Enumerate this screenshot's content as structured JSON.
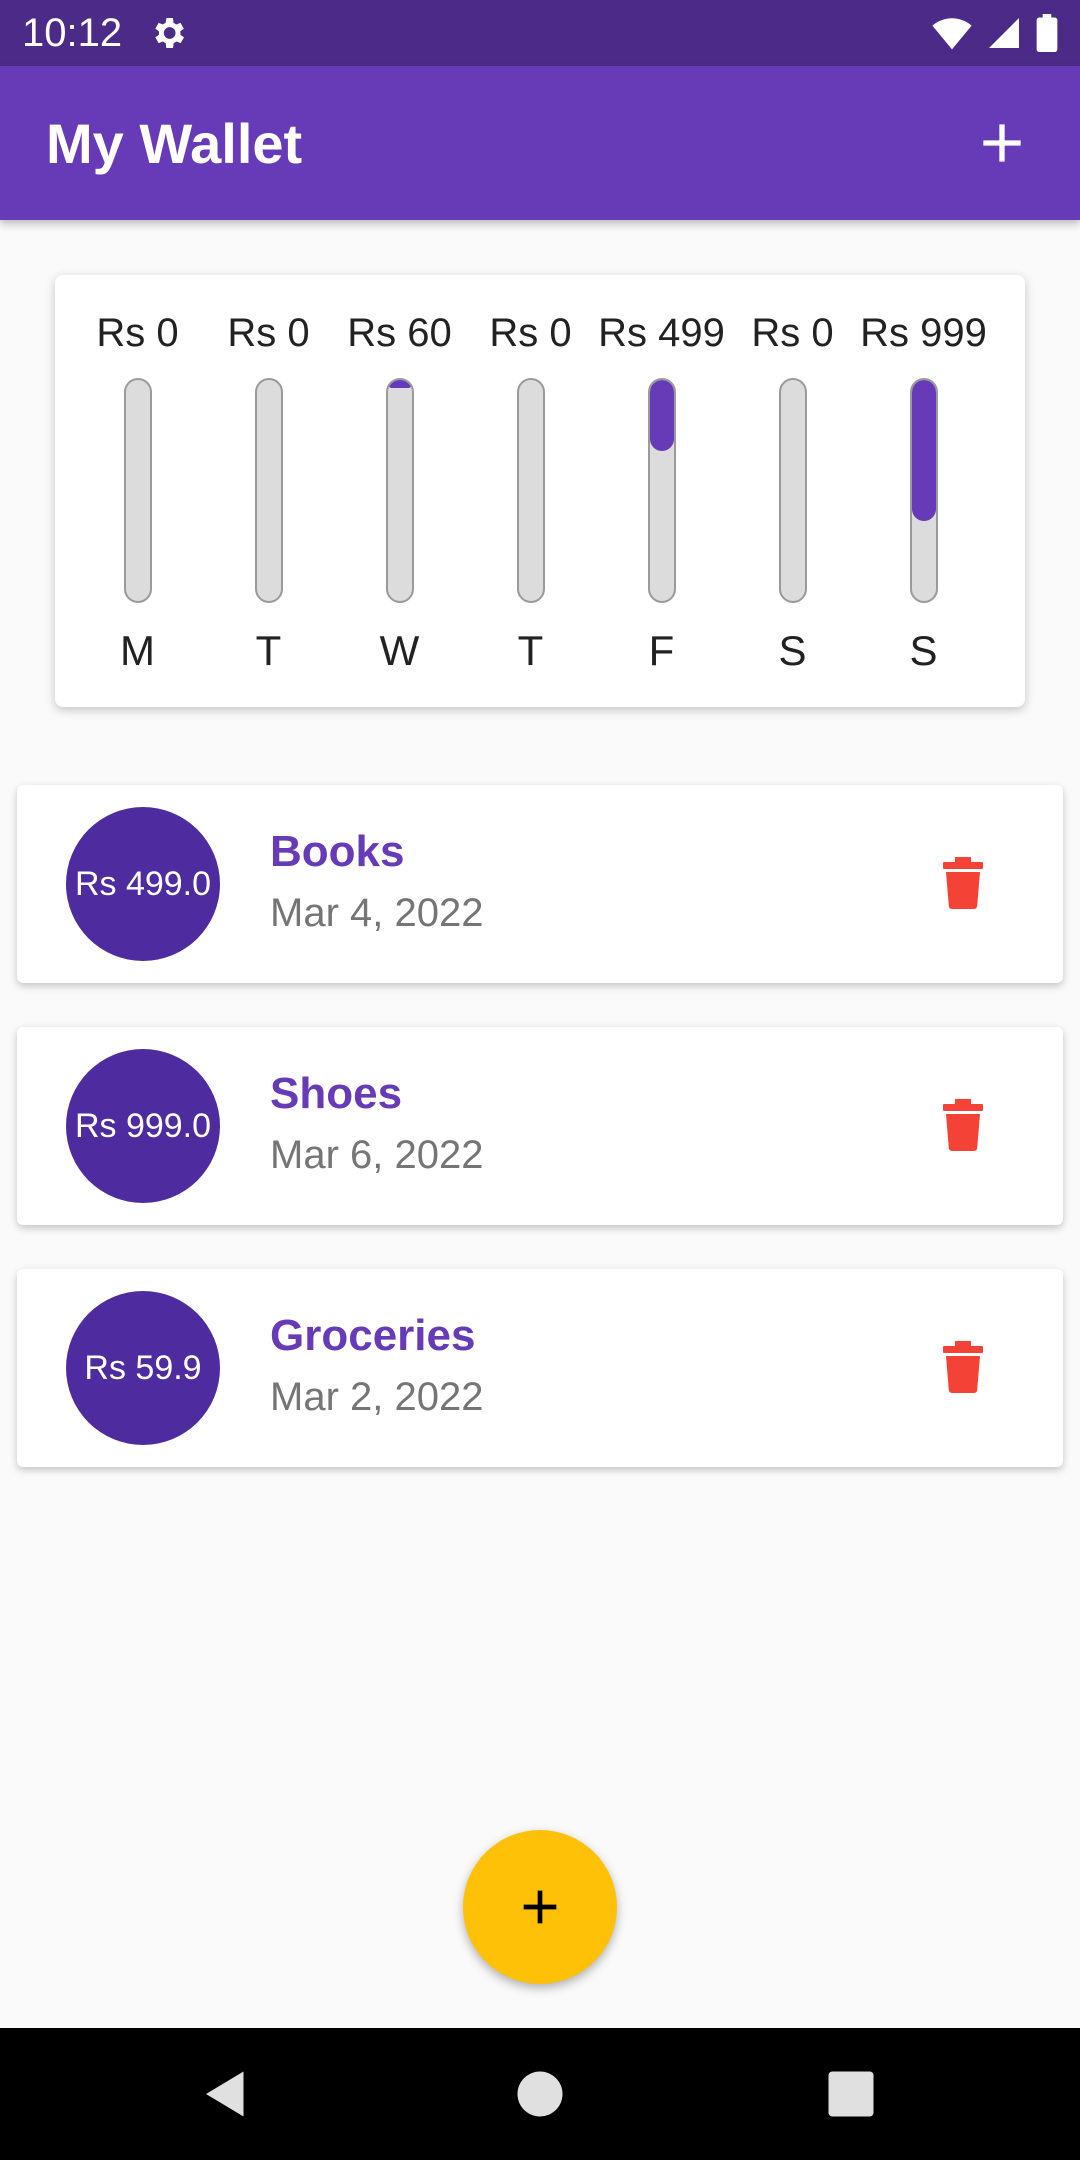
{
  "status_bar": {
    "time": "10:12",
    "icons": [
      "gear-icon",
      "wifi-icon",
      "signal-icon",
      "battery-icon"
    ]
  },
  "app_bar": {
    "title": "My Wallet",
    "add_icon": "plus-icon"
  },
  "chart_data": {
    "type": "bar",
    "categories": [
      "M",
      "T",
      "W",
      "T",
      "F",
      "S",
      "S"
    ],
    "values": [
      0,
      0,
      60,
      0,
      499,
      0,
      999
    ],
    "value_labels": [
      "Rs 0",
      "Rs 0",
      "Rs 60",
      "Rs 0",
      "Rs 499",
      "Rs 0",
      "Rs 999"
    ],
    "fill_fractions": [
      0,
      0,
      0.038,
      0,
      0.32,
      0,
      0.64
    ],
    "fill_color": "#673ab7",
    "track_color": "#dcdcdc"
  },
  "transactions": [
    {
      "amount": "Rs 499.0",
      "title": "Books",
      "date": "Mar 4, 2022"
    },
    {
      "amount": "Rs 999.0",
      "title": "Shoes",
      "date": "Mar 6, 2022"
    },
    {
      "amount": "Rs 59.9",
      "title": "Groceries",
      "date": "Mar 2, 2022"
    }
  ],
  "fab": {
    "icon": "plus-icon",
    "color": "#ffc107"
  },
  "nav_bar": {
    "icons": [
      "back-icon",
      "home-icon",
      "recents-icon"
    ]
  },
  "colors": {
    "primary": "#673ab7",
    "primary_dark": "#4b2b87",
    "delete": "#f44336",
    "accent": "#ffc107"
  }
}
